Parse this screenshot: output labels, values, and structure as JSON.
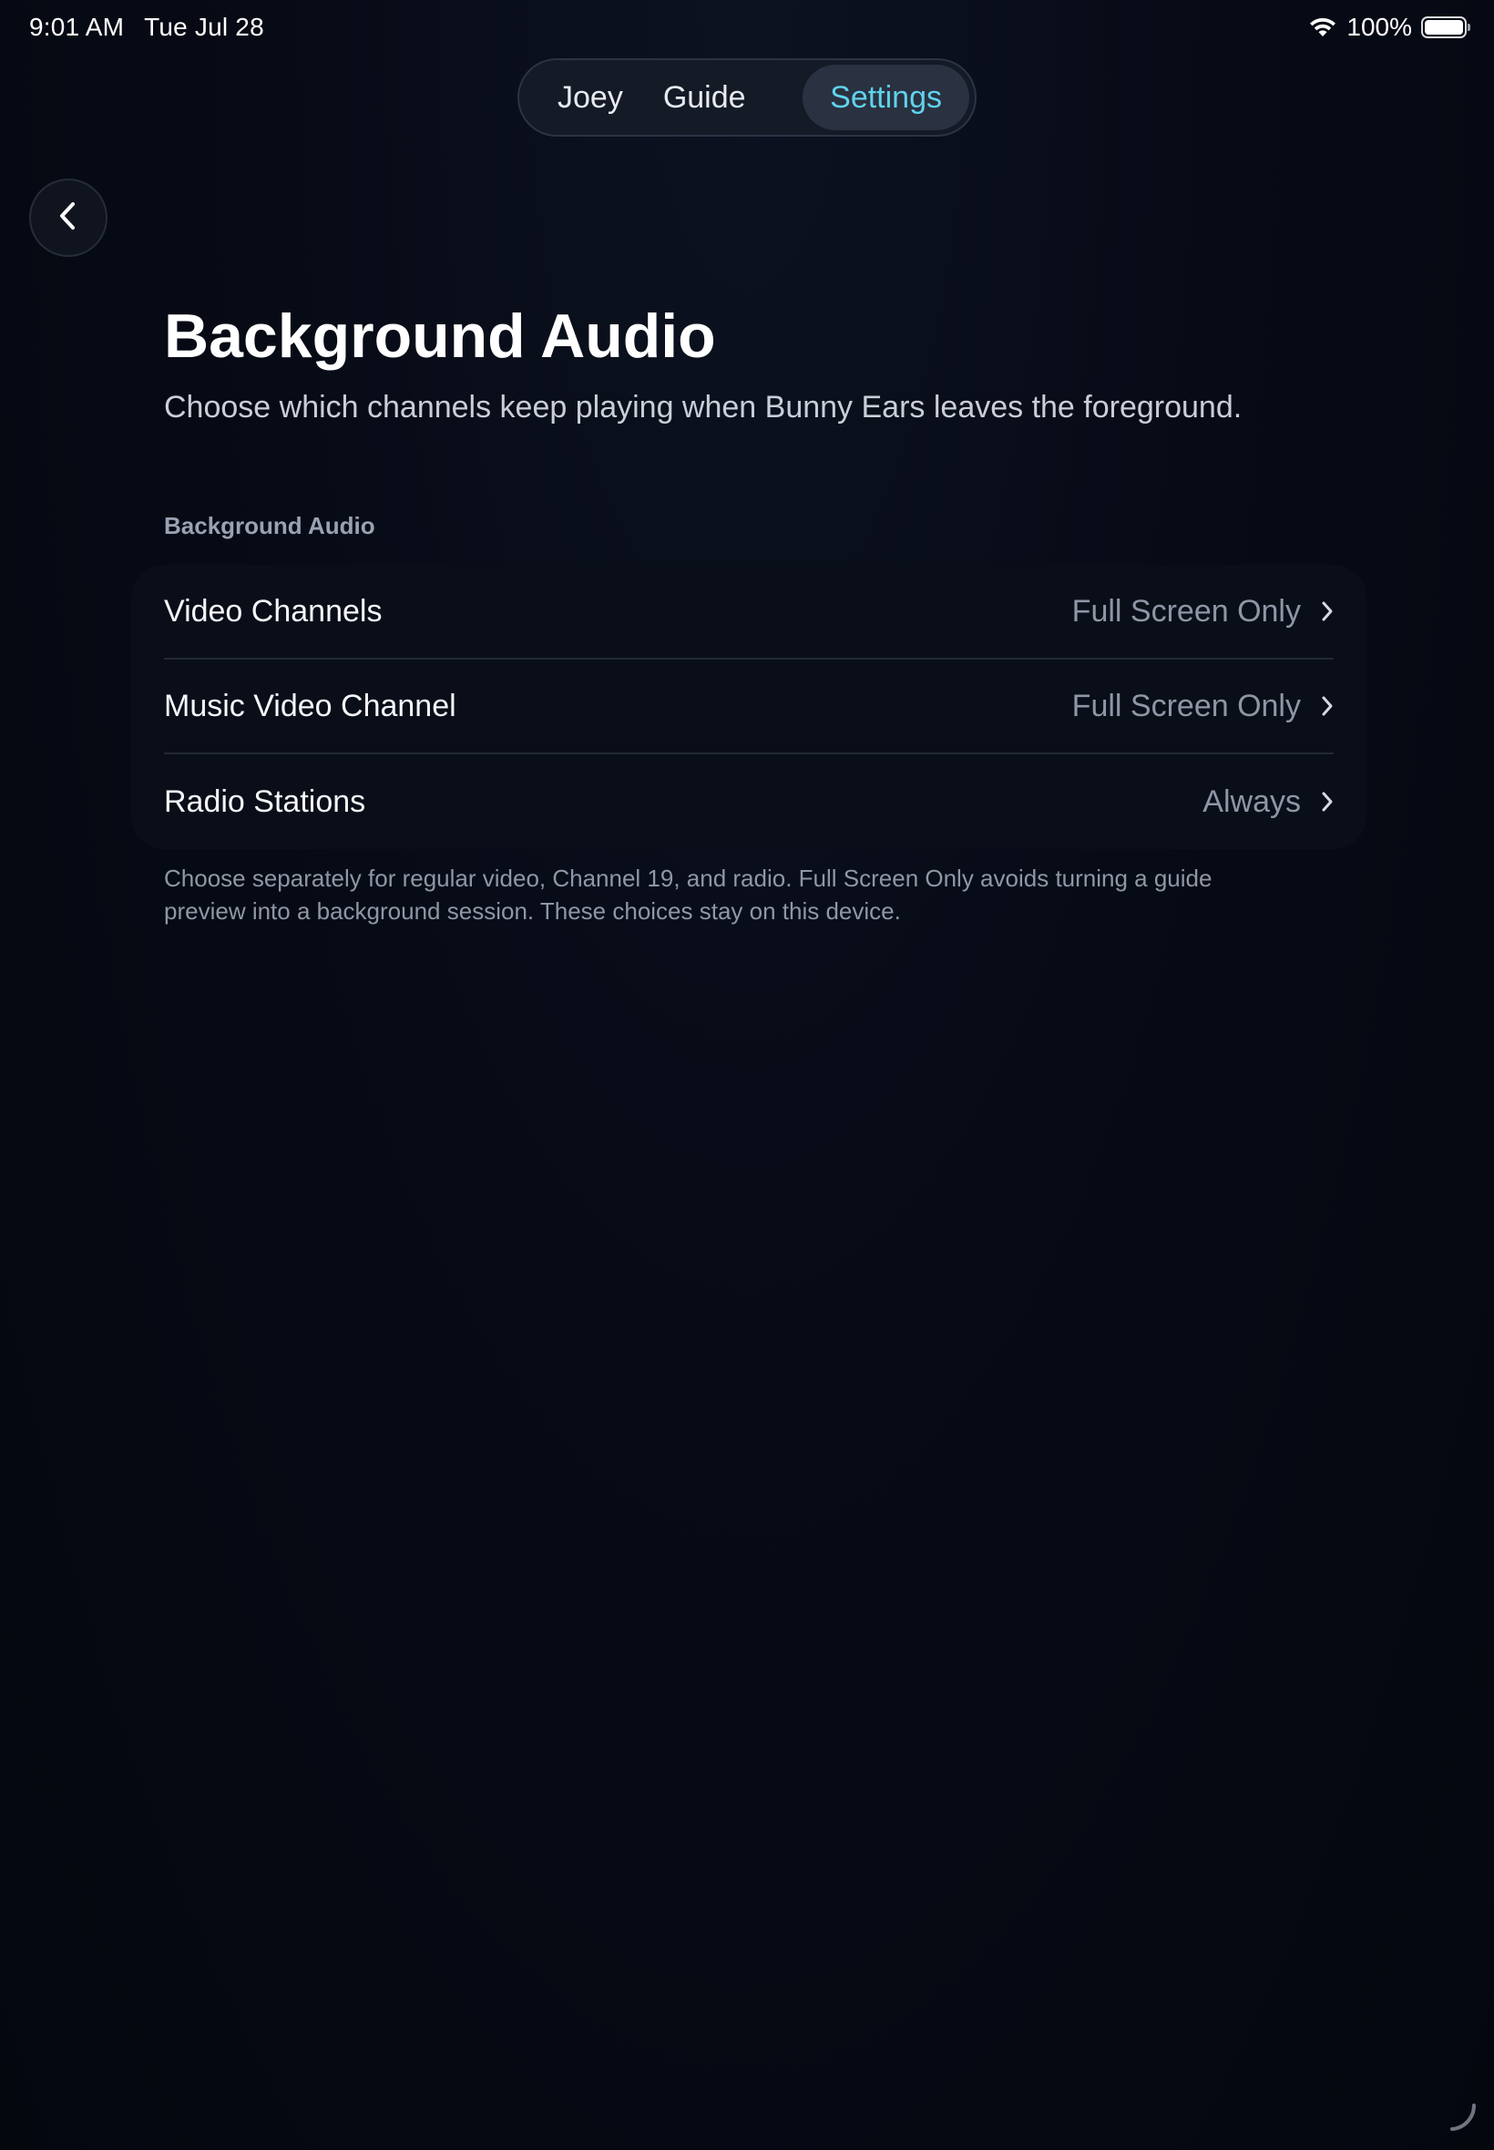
{
  "status_bar": {
    "time": "9:01 AM",
    "date": "Tue Jul 28",
    "battery": "100%",
    "wifi_icon": "wifi-icon",
    "battery_icon": "battery-full-icon"
  },
  "nav": {
    "tabs": [
      {
        "label": "Joey",
        "active": false
      },
      {
        "label": "Guide",
        "active": false
      },
      {
        "label": "Settings",
        "active": true
      }
    ]
  },
  "back_button": {
    "icon": "chevron-left-icon"
  },
  "page": {
    "title": "Background Audio",
    "subtitle": "Choose which channels keep playing when Bunny Ears leaves the foreground."
  },
  "section": {
    "header": "Background Audio",
    "rows": [
      {
        "label": "Video Channels",
        "value": "Full Screen Only"
      },
      {
        "label": "Music Video Channel",
        "value": "Full Screen Only"
      },
      {
        "label": "Radio Stations",
        "value": "Always"
      }
    ],
    "footer": "Choose separately for regular video, Channel 19, and radio. Full Screen Only avoids turning a guide preview into a background session. These choices stay on this device."
  },
  "colors": {
    "background": "#05070f",
    "accent": "#5fd3ec",
    "secondary_text": "#8e96a6"
  }
}
